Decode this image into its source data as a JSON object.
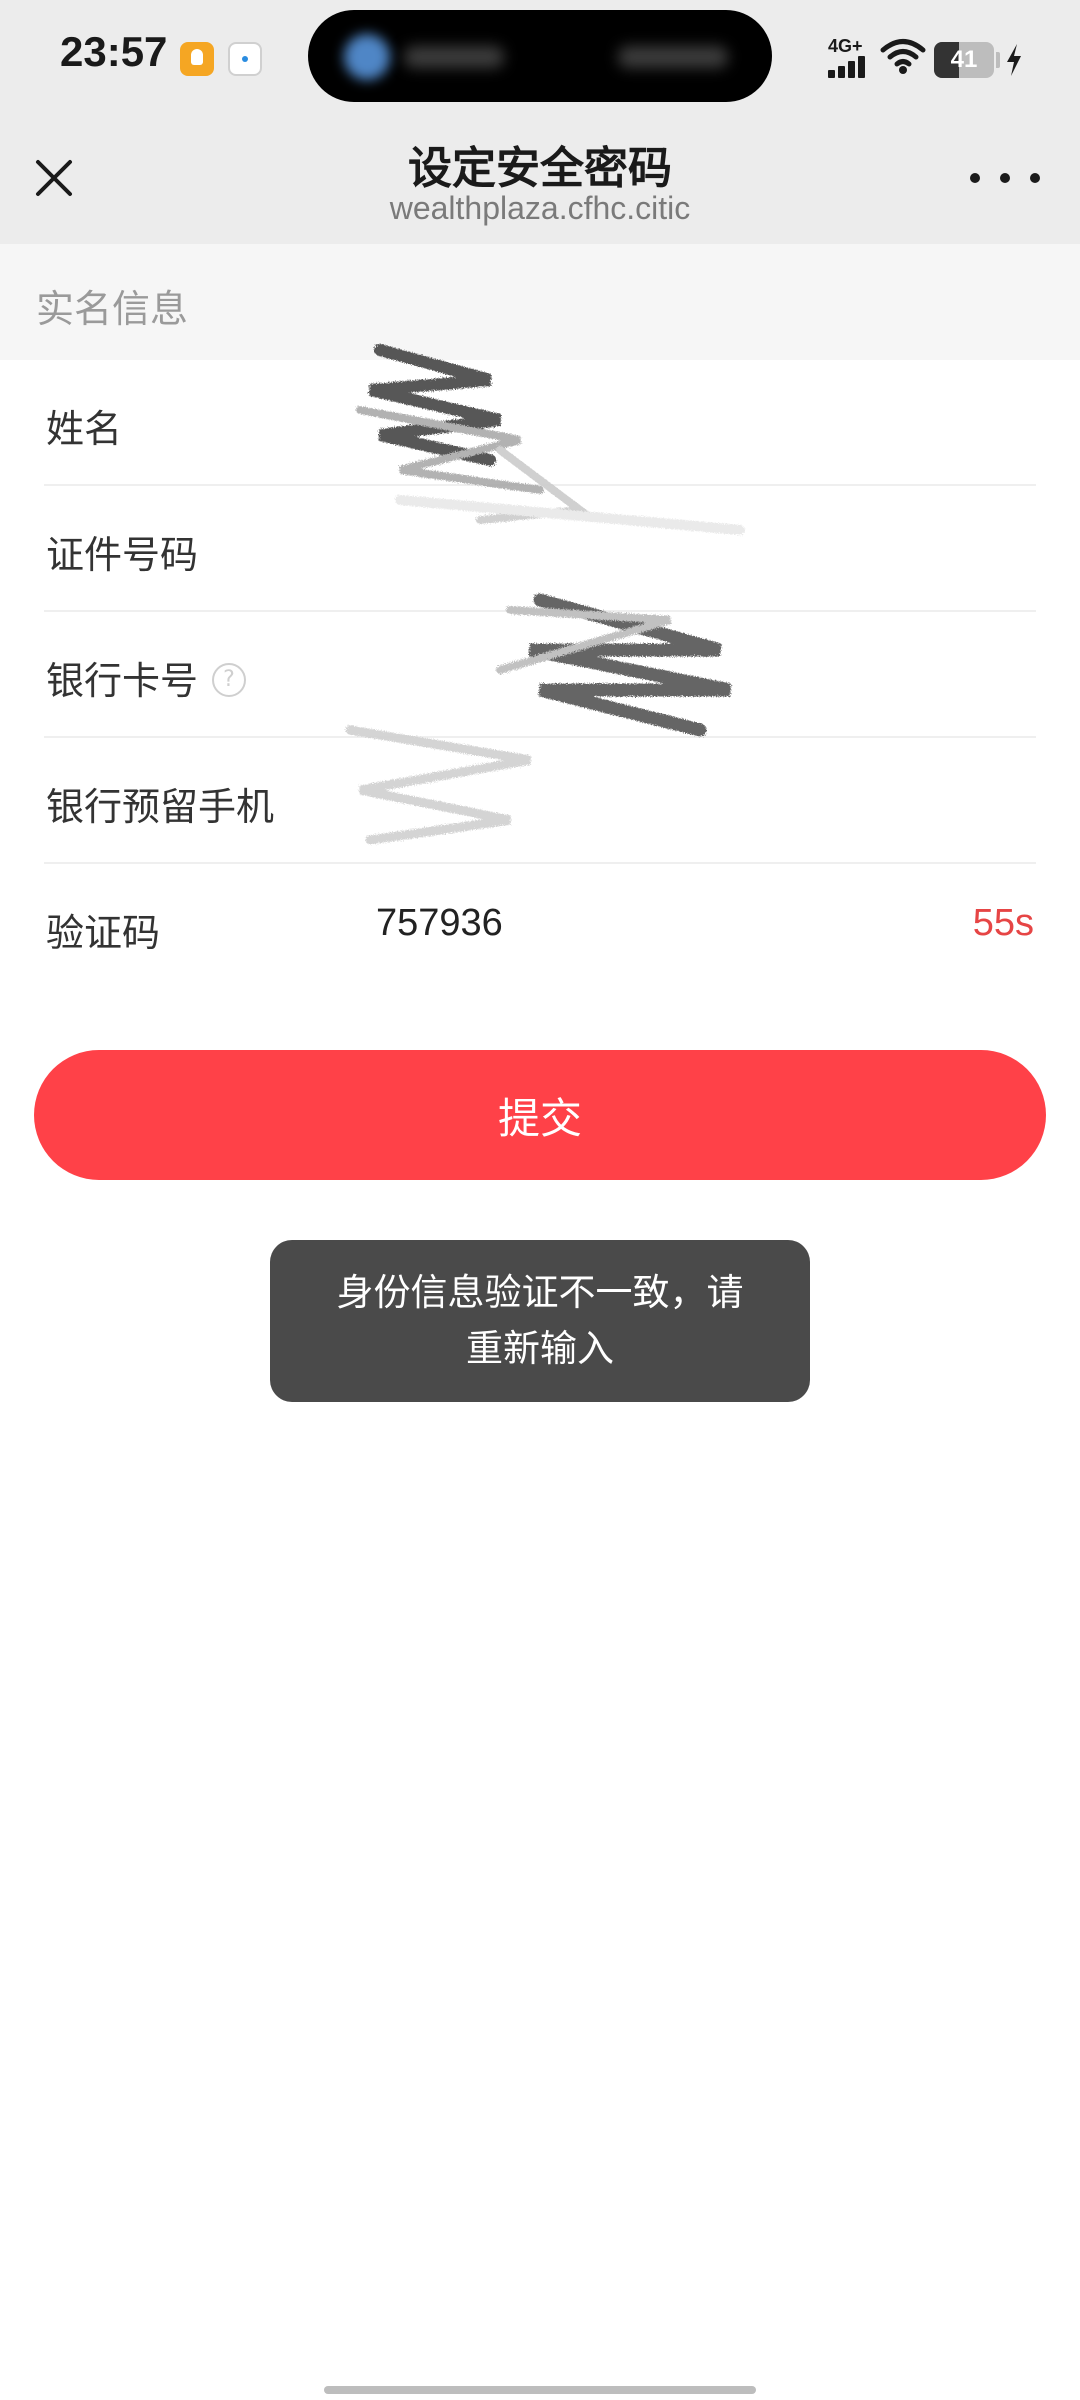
{
  "status_bar": {
    "time": "23:57",
    "network_label": "4G+",
    "battery_level": "41",
    "battery_percent": 41
  },
  "nav": {
    "title": "设定安全密码",
    "url": "wealthplaza.cfhc.citic"
  },
  "section": {
    "header": "实名信息"
  },
  "form": {
    "rows": [
      {
        "label": "姓名",
        "value": ""
      },
      {
        "label": "证件号码",
        "value": ""
      },
      {
        "label": "银行卡号",
        "value": ""
      },
      {
        "label": "银行预留手机",
        "value": ""
      },
      {
        "label": "验证码",
        "value": "757936",
        "countdown": "55s"
      }
    ],
    "info_icon_glyph": "?"
  },
  "submit": {
    "label": "提交"
  },
  "toast": {
    "line1": "身份信息验证不一致，请",
    "line2": "重新输入"
  },
  "colors": {
    "accent": "#ff4148",
    "countdown": "#e64545",
    "toast_bg": "#4a4a4a"
  },
  "icons": {
    "close": "close-icon",
    "more": "more-icon",
    "info": "info-icon"
  }
}
